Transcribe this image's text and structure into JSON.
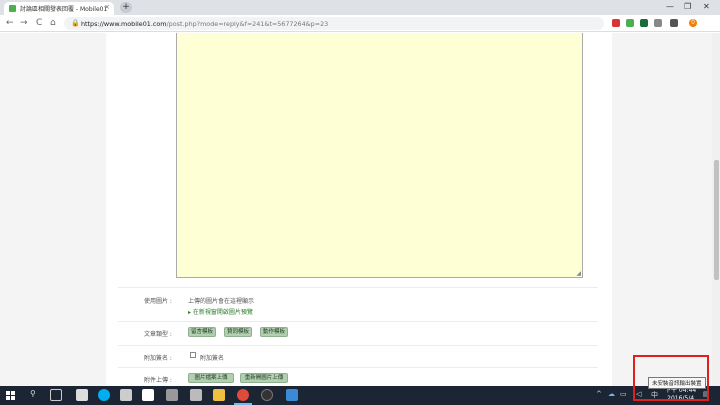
{
  "browser": {
    "tab_title": "討論區相關發表回覆 - Mobile01",
    "tab_close": "×",
    "new_tab": "+",
    "url_host": "https://www.mobile01.com",
    "url_path": "/post.php?mode=reply&f=241&t=5677264&p=23",
    "nav_back": "←",
    "nav_forward": "→",
    "nav_reload": "C",
    "nav_home": "⌂",
    "lock": "🔒",
    "win_min": "—",
    "win_max": "❐",
    "win_close": "✕",
    "profile_initial": "0"
  },
  "form": {
    "resize_glyph": "◢",
    "rows": [
      {
        "label": "使用圖片 :",
        "text": "上傳的圖片會在這裡顯示",
        "link": "▸ 在新視窗開啟圖片預覽"
      },
      {
        "label": "文章類型 :",
        "buttons": [
          "留言模板",
          "贊同模板",
          "動作模板"
        ]
      },
      {
        "label": "附加簽名 :",
        "checkbox_label": "附加簽名"
      },
      {
        "label": "附件上傳 :",
        "buttons": [
          "圖片檔案上傳",
          "重新開圖片上傳"
        ]
      }
    ]
  },
  "taskbar": {
    "search_glyph": "⚲",
    "tray_arrow": "^",
    "tray_ime": "中",
    "time": "下午 04:44",
    "date": "2016/5/4",
    "notification_glyph": "▤"
  },
  "tooltip": {
    "text": "未安裝音訊輸出裝置"
  },
  "colors": {
    "accent_green": "#b2cfb2",
    "textarea_bg": "#ffffd5",
    "taskbar": "#1b2533",
    "highlight": "#e02020"
  }
}
